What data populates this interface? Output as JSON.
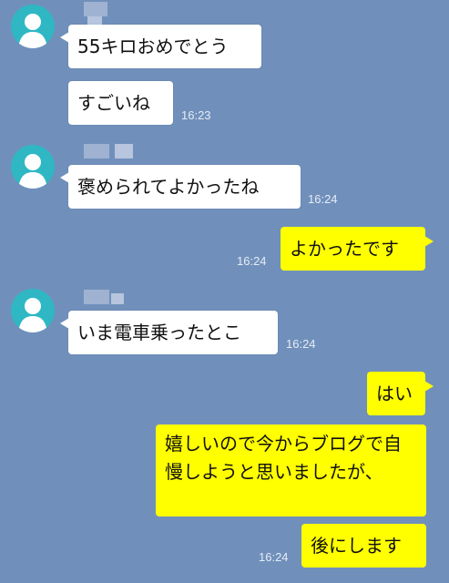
{
  "colors": {
    "background": "#7090bb",
    "incoming_bubble": "#ffffff",
    "outgoing_bubble": "#ffff00",
    "avatar": "#2fb7c4",
    "timestamp": "#e6ecf5"
  },
  "messages": [
    {
      "side": "left",
      "text": "55キロおめでとう",
      "time": ""
    },
    {
      "side": "left",
      "text": "すごいね",
      "time": "16:23"
    },
    {
      "side": "left",
      "text": "褒められてよかったね",
      "time": "16:24"
    },
    {
      "side": "right",
      "text": "よかったです",
      "time": "16:24"
    },
    {
      "side": "left",
      "text": "いま電車乗ったとこ",
      "time": "16:24"
    },
    {
      "side": "right",
      "text": "はい",
      "time": ""
    },
    {
      "side": "right",
      "text": "嬉しいので今からブログで自慢しようと思いましたが、",
      "time": ""
    },
    {
      "side": "right",
      "text": "後にします",
      "time": "16:24"
    }
  ],
  "avatar_icon": "person-silhouette-icon"
}
